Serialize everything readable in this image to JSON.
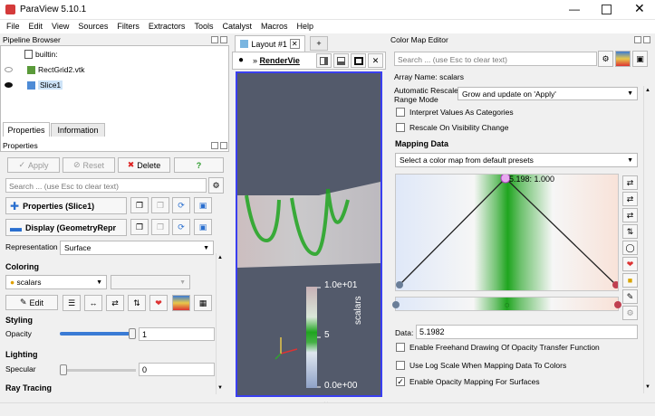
{
  "window": {
    "title": "ParaView 5.10.1"
  },
  "menu": [
    "File",
    "Edit",
    "View",
    "Sources",
    "Filters",
    "Extractors",
    "Tools",
    "Catalyst",
    "Macros",
    "Help"
  ],
  "pipeline": {
    "title": "Pipeline Browser",
    "items": [
      {
        "label": "builtin:",
        "icon": "server-icon"
      },
      {
        "label": "RectGrid2.vtk",
        "icon": "dataset-icon"
      },
      {
        "label": "Slice1",
        "icon": "slice-icon"
      }
    ]
  },
  "tabs": {
    "properties": "Properties",
    "information": "Information"
  },
  "properties": {
    "title": "Properties",
    "apply": "Apply",
    "reset": "Reset",
    "delete": "Delete",
    "help": "?",
    "search_placeholder": "Search ... (use Esc to clear text)",
    "section_props": "Properties (Slice1)",
    "section_display": "Display (GeometryRepr",
    "representation_label": "Representation",
    "representation_value": "Surface",
    "coloring": "Coloring",
    "color_by": "scalars",
    "edit": "Edit",
    "styling": "Styling",
    "opacity_label": "Opacity",
    "opacity_value": "1",
    "lighting": "Lighting",
    "specular_label": "Specular",
    "specular_value": "0",
    "ray_tracing": "Ray Tracing",
    "opacity_level": 1.0,
    "specular_level": 0.0
  },
  "layout": {
    "tab": "Layout #1",
    "add_tab": "+",
    "view_label": "RenderVie",
    "colorbar": {
      "max": "1.0e+01",
      "mid": "5",
      "min": "0.0e+00",
      "title": "scalars"
    }
  },
  "cme": {
    "title": "Color Map Editor",
    "search_placeholder": "Search ... (use Esc to clear text)",
    "array_name": "Array Name: scalars",
    "auto_rescale_label": "Automatic Rescale\nRange Mode",
    "auto_rescale_value": "Grow and update on 'Apply'",
    "interpret_cat": "Interpret Values As Categories",
    "rescale_visible": "Rescale On Visibility Change",
    "mapping_data": "Mapping Data",
    "preset": "Select a color map from default presets",
    "point_label": "5.198: 1.000",
    "data_label": "Data:",
    "data_value": "5.1982",
    "freehand": "Enable Freehand Drawing Of Opacity Transfer Function",
    "log_scale": "Use Log Scale When Mapping Data To Colors",
    "opacity_mapping": "Enable Opacity Mapping For Surfaces",
    "checks": {
      "interpret_cat": false,
      "rescale_visible": false,
      "freehand": false,
      "log_scale": false,
      "opacity_mapping": true
    }
  },
  "colors": {
    "accent": "#3a7bd5",
    "view_bg": "#535a6b",
    "green": "#1fa51f"
  }
}
